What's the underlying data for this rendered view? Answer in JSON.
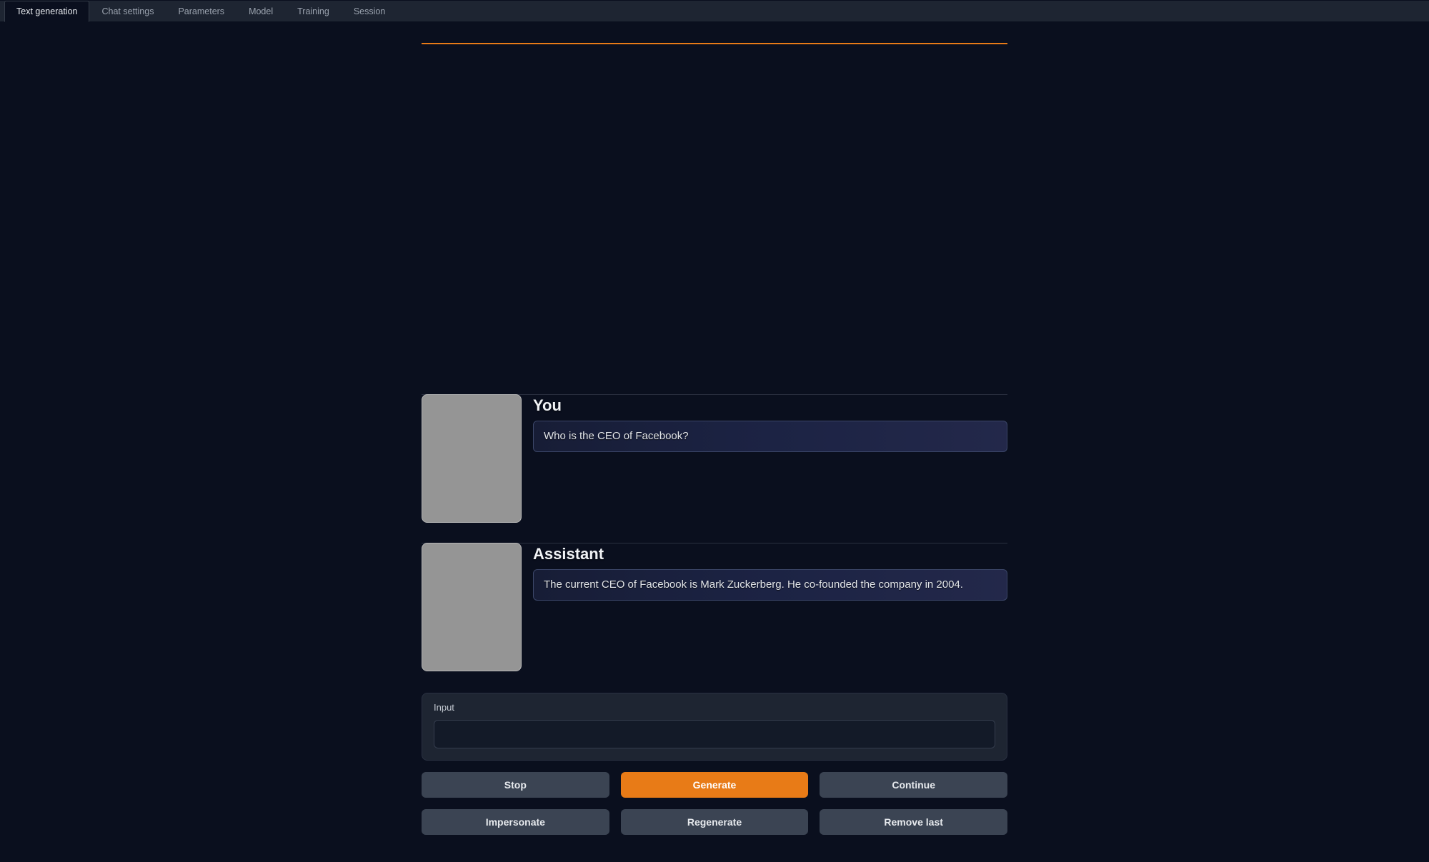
{
  "tabs": [
    {
      "label": "Text generation",
      "active": true
    },
    {
      "label": "Chat settings",
      "active": false
    },
    {
      "label": "Parameters",
      "active": false
    },
    {
      "label": "Model",
      "active": false
    },
    {
      "label": "Training",
      "active": false
    },
    {
      "label": "Session",
      "active": false
    }
  ],
  "chat": {
    "messages": [
      {
        "speaker": "You",
        "text": "Who is the CEO of Facebook?"
      },
      {
        "speaker": "Assistant",
        "text": "The current CEO of Facebook is Mark Zuckerberg. He co-founded the company in 2004."
      }
    ]
  },
  "input": {
    "label": "Input",
    "value": "",
    "placeholder": ""
  },
  "buttons": {
    "stop": "Stop",
    "generate": "Generate",
    "continue": "Continue",
    "impersonate": "Impersonate",
    "regenerate": "Regenerate",
    "remove_last": "Remove last"
  },
  "colors": {
    "accent": "#e87b17",
    "bg": "#0a0f1e",
    "panel": "#1e2532"
  }
}
